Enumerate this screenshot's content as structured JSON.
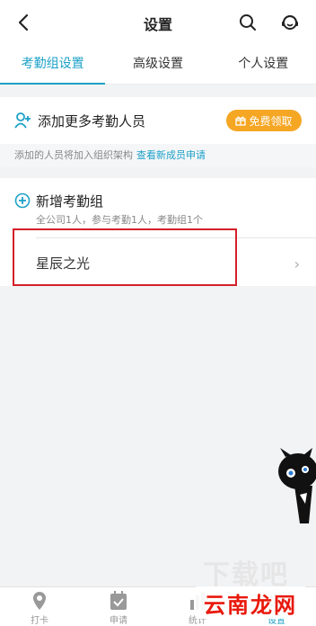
{
  "header": {
    "title": "设置",
    "back_icon": "back-arrow-icon",
    "search_icon": "search-icon",
    "support_icon": "headset-icon"
  },
  "tabs": [
    {
      "label": "考勤组设置",
      "active": true
    },
    {
      "label": "高级设置",
      "active": false
    },
    {
      "label": "个人设置",
      "active": false
    }
  ],
  "add_members": {
    "label": "添加更多考勤人员",
    "promo_label": "免费领取",
    "hint": "添加的人员将加入组织架构",
    "hint_link": "查看新成员申请"
  },
  "group_section": {
    "title": "新增考勤组",
    "subtitle": "全公司1人，参与考勤1人，考勤组1个",
    "items": [
      {
        "name": "星辰之光"
      }
    ]
  },
  "bottom_tabs": [
    {
      "label": "打卡",
      "icon": "location-pin-icon"
    },
    {
      "label": "申请",
      "icon": "calendar-check-icon"
    },
    {
      "label": "统计",
      "icon": "stats-icon"
    },
    {
      "label": "设置",
      "icon": "gear-icon",
      "active": true
    }
  ],
  "watermark": {
    "text": "下载吧",
    "logo_text": "云南龙网"
  },
  "colors": {
    "accent": "#1da1c8",
    "promo": "#f5a623",
    "highlight": "#d3202a"
  }
}
